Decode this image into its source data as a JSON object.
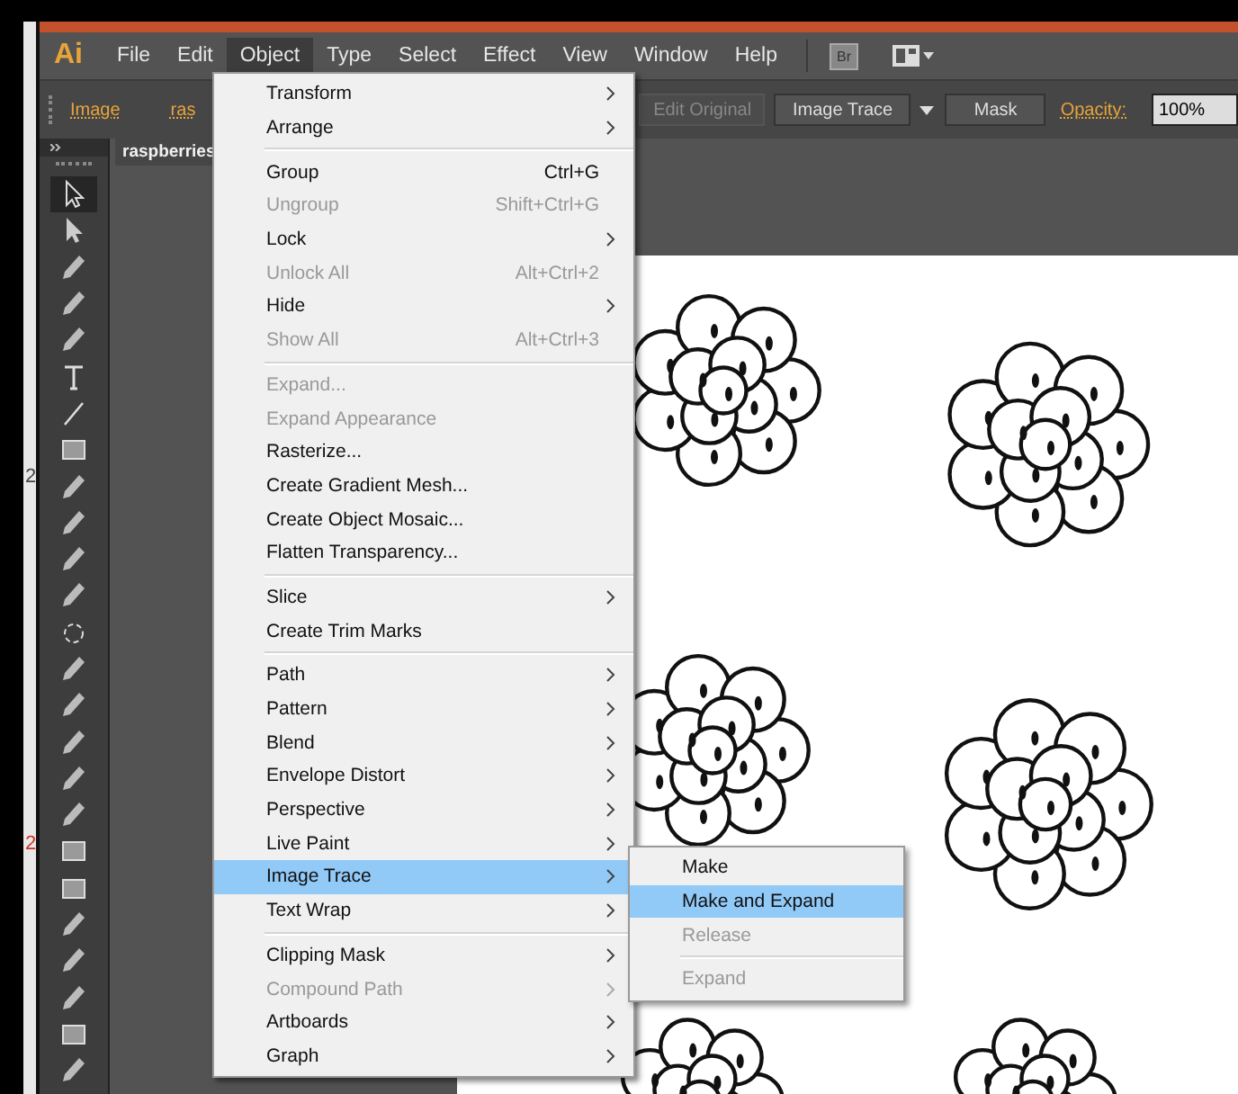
{
  "left_edge": {
    "marks": [
      {
        "text": "2",
        "color": "#444444"
      },
      {
        "text": "2",
        "color": "#cc3322"
      }
    ]
  },
  "app": {
    "logo": "Ai"
  },
  "menubar": {
    "items": [
      {
        "label": "File",
        "selected": false
      },
      {
        "label": "Edit",
        "selected": false
      },
      {
        "label": "Object",
        "selected": true
      },
      {
        "label": "Type",
        "selected": false
      },
      {
        "label": "Select",
        "selected": false
      },
      {
        "label": "Effect",
        "selected": false
      },
      {
        "label": "View",
        "selected": false
      },
      {
        "label": "Window",
        "selected": false
      },
      {
        "label": "Help",
        "selected": false
      }
    ],
    "bridge": "Br"
  },
  "control_bar": {
    "link": "Image",
    "file_name": "ras",
    "edit_original": "Edit Original",
    "image_trace": "Image Trace",
    "mask": "Mask",
    "opacity_label": "Opacity:",
    "opacity_value": "100%"
  },
  "document_tab": {
    "title": "raspberries"
  },
  "tools": [
    {
      "kind": "selection",
      "selected": true
    },
    {
      "kind": "direct",
      "selected": false
    },
    {
      "kind": "wand",
      "selected": false
    },
    {
      "kind": "lasso",
      "selected": false
    },
    {
      "kind": "pen",
      "selected": false
    },
    {
      "kind": "type",
      "selected": false
    },
    {
      "kind": "line",
      "selected": false
    },
    {
      "kind": "rect",
      "selected": false
    },
    {
      "kind": "brush",
      "selected": false
    },
    {
      "kind": "pencil",
      "selected": false
    },
    {
      "kind": "blob",
      "selected": false
    },
    {
      "kind": "eraser",
      "selected": false
    },
    {
      "kind": "rotate",
      "selected": false
    },
    {
      "kind": "scale",
      "selected": false
    },
    {
      "kind": "warp",
      "selected": false
    },
    {
      "kind": "transform",
      "selected": false
    },
    {
      "kind": "shape",
      "selected": false
    },
    {
      "kind": "graph",
      "selected": false
    },
    {
      "kind": "mesh",
      "selected": false
    },
    {
      "kind": "gradient",
      "selected": false
    },
    {
      "kind": "eyedropper",
      "selected": false
    },
    {
      "kind": "blend",
      "selected": false
    },
    {
      "kind": "symbol",
      "selected": false
    },
    {
      "kind": "column",
      "selected": false
    },
    {
      "kind": "artboard",
      "selected": false
    }
  ],
  "object_menu": {
    "items": [
      {
        "kind": "item",
        "label": "Transform",
        "submenu": true,
        "disabled": false,
        "selected": false
      },
      {
        "kind": "item",
        "label": "Arrange",
        "submenu": true,
        "disabled": false,
        "selected": false
      },
      {
        "kind": "separator"
      },
      {
        "kind": "item",
        "label": "Group",
        "shortcut": "Ctrl+G",
        "submenu": false,
        "disabled": false,
        "selected": false
      },
      {
        "kind": "item",
        "label": "Ungroup",
        "shortcut": "Shift+Ctrl+G",
        "submenu": false,
        "disabled": true,
        "selected": false
      },
      {
        "kind": "item",
        "label": "Lock",
        "submenu": true,
        "disabled": false,
        "selected": false
      },
      {
        "kind": "item",
        "label": "Unlock All",
        "shortcut": "Alt+Ctrl+2",
        "submenu": false,
        "disabled": true,
        "selected": false
      },
      {
        "kind": "item",
        "label": "Hide",
        "submenu": true,
        "disabled": false,
        "selected": false
      },
      {
        "kind": "item",
        "label": "Show All",
        "shortcut": "Alt+Ctrl+3",
        "submenu": false,
        "disabled": true,
        "selected": false
      },
      {
        "kind": "separator"
      },
      {
        "kind": "item",
        "label": "Expand...",
        "submenu": false,
        "disabled": true,
        "selected": false
      },
      {
        "kind": "item",
        "label": "Expand Appearance",
        "submenu": false,
        "disabled": true,
        "selected": false
      },
      {
        "kind": "item",
        "label": "Rasterize...",
        "submenu": false,
        "disabled": false,
        "selected": false
      },
      {
        "kind": "item",
        "label": "Create Gradient Mesh...",
        "submenu": false,
        "disabled": false,
        "selected": false
      },
      {
        "kind": "item",
        "label": "Create Object Mosaic...",
        "submenu": false,
        "disabled": false,
        "selected": false
      },
      {
        "kind": "item",
        "label": "Flatten Transparency...",
        "submenu": false,
        "disabled": false,
        "selected": false
      },
      {
        "kind": "separator"
      },
      {
        "kind": "item",
        "label": "Slice",
        "submenu": true,
        "disabled": false,
        "selected": false
      },
      {
        "kind": "item",
        "label": "Create Trim Marks",
        "submenu": false,
        "disabled": false,
        "selected": false
      },
      {
        "kind": "separator"
      },
      {
        "kind": "item",
        "label": "Path",
        "submenu": true,
        "disabled": false,
        "selected": false
      },
      {
        "kind": "item",
        "label": "Pattern",
        "submenu": true,
        "disabled": false,
        "selected": false
      },
      {
        "kind": "item",
        "label": "Blend",
        "submenu": true,
        "disabled": false,
        "selected": false
      },
      {
        "kind": "item",
        "label": "Envelope Distort",
        "submenu": true,
        "disabled": false,
        "selected": false
      },
      {
        "kind": "item",
        "label": "Perspective",
        "submenu": true,
        "disabled": false,
        "selected": false
      },
      {
        "kind": "item",
        "label": "Live Paint",
        "submenu": true,
        "disabled": false,
        "selected": false
      },
      {
        "kind": "item",
        "label": "Image Trace",
        "submenu": true,
        "disabled": false,
        "selected": true
      },
      {
        "kind": "item",
        "label": "Text Wrap",
        "submenu": true,
        "disabled": false,
        "selected": false
      },
      {
        "kind": "separator"
      },
      {
        "kind": "item",
        "label": "Clipping Mask",
        "submenu": true,
        "disabled": false,
        "selected": false
      },
      {
        "kind": "item",
        "label": "Compound Path",
        "submenu": true,
        "disabled": true,
        "selected": false
      },
      {
        "kind": "item",
        "label": "Artboards",
        "submenu": true,
        "disabled": false,
        "selected": false
      },
      {
        "kind": "item",
        "label": "Graph",
        "submenu": true,
        "disabled": false,
        "selected": false
      }
    ]
  },
  "image_trace_submenu": {
    "items": [
      {
        "kind": "item",
        "label": "Make",
        "disabled": false,
        "selected": false
      },
      {
        "kind": "item",
        "label": "Make and Expand",
        "disabled": false,
        "selected": true
      },
      {
        "kind": "item",
        "label": "Release",
        "disabled": true,
        "selected": false
      },
      {
        "kind": "separator"
      },
      {
        "kind": "item",
        "label": "Expand",
        "disabled": true,
        "selected": false
      }
    ]
  }
}
